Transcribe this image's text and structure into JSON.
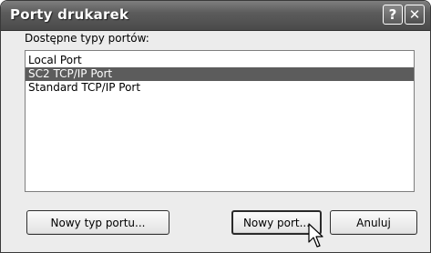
{
  "window": {
    "title": "Porty drukarek",
    "help_glyph": "?",
    "close_glyph": "✕"
  },
  "main": {
    "label": "Dostępne typy portów:",
    "port_types": [
      {
        "label": "Local Port",
        "selected": false
      },
      {
        "label": "SC2 TCP/IP Port",
        "selected": true
      },
      {
        "label": "Standard TCP/IP Port",
        "selected": false
      }
    ]
  },
  "buttons": {
    "new_port_type": "Nowy typ portu...",
    "new_port": "Nowy port...",
    "cancel": "Anuluj"
  },
  "colors": {
    "titlebar": "#5c5c5c",
    "selection": "#5c5c5c",
    "dialog_bg": "#ececec"
  },
  "icons": {
    "help": "help-icon",
    "close": "close-icon",
    "cursor": "mouse-pointer-icon"
  }
}
